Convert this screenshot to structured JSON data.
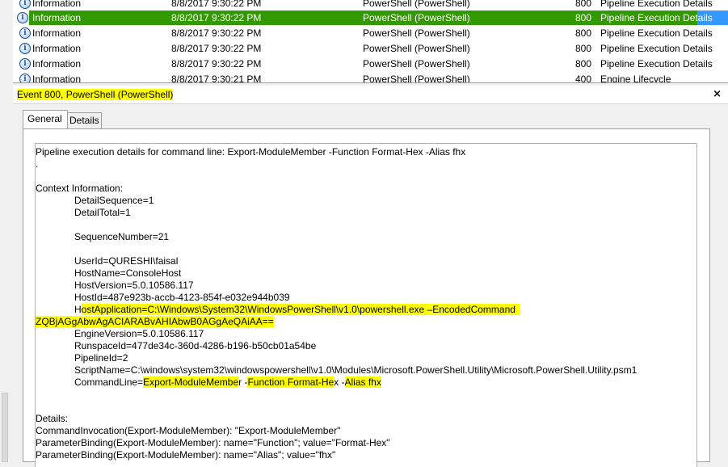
{
  "event_list": {
    "rows": [
      {
        "level": "Information",
        "date": "8/8/2017 9:30:22 PM",
        "source": "PowerShell (PowerShell)",
        "id": "800",
        "task": "Pipeline Execution Details"
      },
      {
        "level": "Information",
        "date": "8/8/2017 9:30:22 PM",
        "source": "PowerShell (PowerShell)",
        "id": "800",
        "task": "Pipeline Execution Details",
        "selected": true
      },
      {
        "level": "Information",
        "date": "8/8/2017 9:30:22 PM",
        "source": "PowerShell (PowerShell)",
        "id": "800",
        "task": "Pipeline Execution Details"
      },
      {
        "level": "Information",
        "date": "8/8/2017 9:30:22 PM",
        "source": "PowerShell (PowerShell)",
        "id": "800",
        "task": "Pipeline Execution Details"
      },
      {
        "level": "Information",
        "date": "8/8/2017 9:30:22 PM",
        "source": "PowerShell (PowerShell)",
        "id": "800",
        "task": "Pipeline Execution Details"
      },
      {
        "level": "Information",
        "date": "8/8/2017 9:30:21 PM",
        "source": "PowerShell (PowerShell)",
        "id": "400",
        "task": "Engine Lifecycle"
      }
    ],
    "selection_color": "#339900"
  },
  "detail_header": {
    "title": "Event 800, PowerShell (PowerShell)",
    "close": "×"
  },
  "tabs": {
    "general": "General",
    "details": "Details"
  },
  "description": {
    "line1": "Pipeline execution details for command line: Export-ModuleMember -Function Format-Hex -Alias fhx",
    "line2": ".",
    "context_header": "Context Information:",
    "detail_sequence": "DetailSequence=1",
    "detail_total": "DetailTotal=1",
    "sequence_number": "SequenceNumber=21",
    "user_id": "UserId=QURESHI\\faisal",
    "host_name": "HostName=ConsoleHost",
    "host_version": "HostVersion=5.0.10586.117",
    "host_id": "HostId=487e923b-accb-4123-854f-e032e944b039",
    "host_application_prefix": "H",
    "host_application": "ostApplication=C:\\Windows\\System32\\WindowsPowerShell\\v1.0\\powershell.exe –EncodedCommand",
    "encoded_command": "ZQBjAGgAbwAgACIARABvAHIAbwB0AGgAeQAiAA==",
    "engine_version": "EngineVersion=5.0.10586.117",
    "runspace_id": "RunspaceId=477de34c-360d-4286-b196-b50cb01a54be",
    "pipeline_id": "PipelineId=2",
    "script_name": "ScriptName=C:\\windows\\system32\\windowspowershell\\v1.0\\Modules\\Microsoft.PowerShell.Utility\\Microsoft.PowerShell.Utility.psm1",
    "cmd_label": "CommandLine=",
    "cmd_part1": "Export-ModuleMembe",
    "cmd_part2": "r -",
    "cmd_part3": "Function Format-He",
    "cmd_part4": "x -",
    "cmd_part5": "Alias fhx",
    "details_header": "Details:",
    "invocation": "CommandInvocation(Export-ModuleMember): \"Export-ModuleMember\"",
    "binding1": "ParameterBinding(Export-ModuleMember): name=\"Function\"; value=\"Format-Hex\"",
    "binding2": "ParameterBinding(Export-ModuleMember): name=\"Alias\"; value=\"fhx\""
  }
}
